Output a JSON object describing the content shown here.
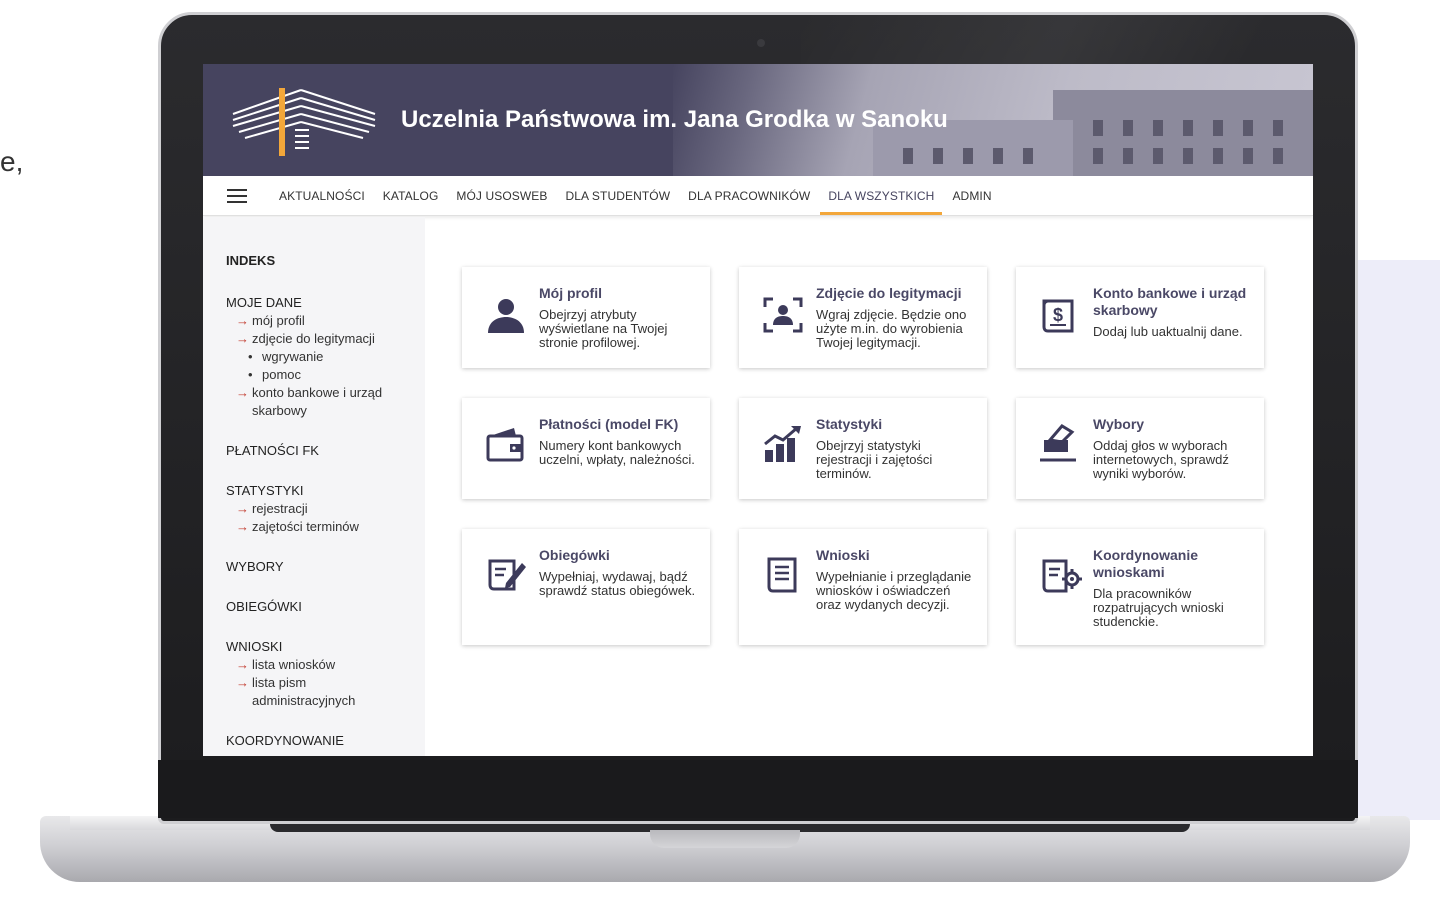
{
  "page": {
    "cut_text": "e,"
  },
  "header": {
    "title": "Uczelnia Państwowa im. Jana Grodka w Sanoku"
  },
  "nav": {
    "items": [
      "AKTUALNOŚCI",
      "KATALOG",
      "MÓJ USOSWEB",
      "DLA STUDENTÓW",
      "DLA PRACOWNIKÓW",
      "DLA WSZYSTKICH",
      "ADMIN"
    ],
    "active_index": 5
  },
  "sidebar": {
    "heading": "INDEKS",
    "moje_dane": "MOJE DANE",
    "moj_profil": "mój profil",
    "zdjecie": "zdjęcie do legitymacji",
    "wgrywanie": "wgrywanie",
    "pomoc": "pomoc",
    "konto": "konto bankowe i urząd skarbowy",
    "platnosci": "PŁATNOŚCI FK",
    "statystyki": "STATYSTYKI",
    "rejestracji": "rejestracji",
    "zajetosci": "zajętości terminów",
    "wybory": "WYBORY",
    "obiegowki": "OBIEGÓWKI",
    "wnioski": "WNIOSKI",
    "lista_wnioskow": "lista wniosków",
    "lista_pism": "lista pism administracyjnych",
    "koordynowanie": "KOORDYNOWANIE"
  },
  "tiles": [
    {
      "title": "Mój profil",
      "desc": "Obejrzyj atrybuty wyświetlane na Twojej stronie profilowej.",
      "icon": "user-icon"
    },
    {
      "title": "Zdjęcie do legitymacji",
      "desc": "Wgraj zdjęcie. Będzie ono użyte m.in. do wyrobienia Twojej legitymacji.",
      "icon": "photo-id-icon"
    },
    {
      "title": "Konto bankowe i urząd skarbowy",
      "desc": "Dodaj lub uaktualnij dane.",
      "icon": "bank-document-icon"
    },
    {
      "title": "Płatności (model FK)",
      "desc": "Numery kont bankowych uczelni, wpłaty, należności.",
      "icon": "wallet-icon"
    },
    {
      "title": "Statystyki",
      "desc": "Obejrzyj statystyki rejestracji i zajętości terminów.",
      "icon": "chart-icon"
    },
    {
      "title": "Wybory",
      "desc": "Oddaj głos w wyborach internetowych, sprawdź wyniki wyborów.",
      "icon": "ballot-icon"
    },
    {
      "title": "Obiegówki",
      "desc": "Wypełniaj, wydawaj, bądź sprawdź status obiegówek.",
      "icon": "edit-document-icon"
    },
    {
      "title": "Wnioski",
      "desc": "Wypełnianie i przeglądanie wniosków i oświadczeń oraz wydanych decyzji.",
      "icon": "document-icon"
    },
    {
      "title": "Koordynowanie wnioskami",
      "desc": "Dla pracowników rozpatrujących wnioski studenckie.",
      "icon": "document-settings-icon"
    }
  ],
  "colors": {
    "header": "#46445f",
    "accent": "#f3a73a",
    "tile_title": "#4a4866",
    "arrow": "#c23a2e"
  }
}
